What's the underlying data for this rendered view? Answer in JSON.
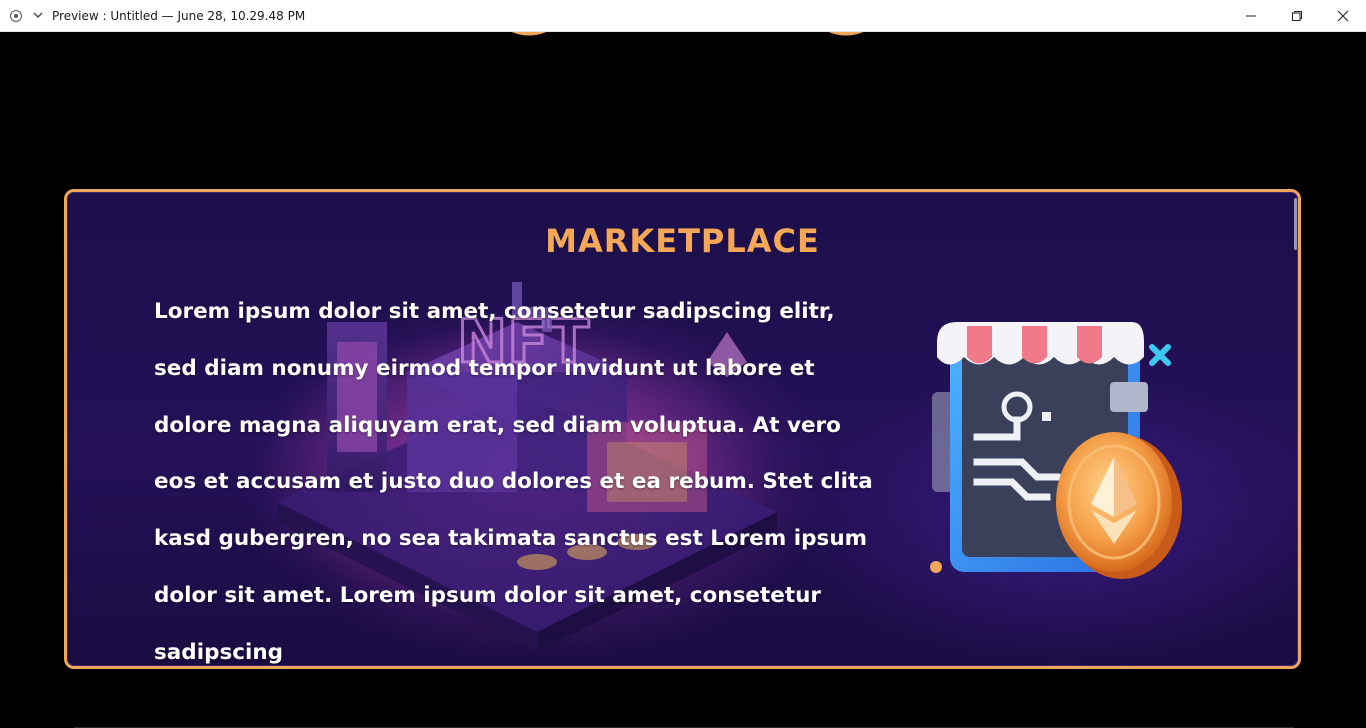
{
  "window": {
    "title": "Preview : Untitled — June 28, 10.29.48 PM"
  },
  "card": {
    "title": "MARKETPLACE",
    "body": "Lorem ipsum dolor sit amet, consetetur sadipscing elitr, sed diam nonumy eirmod tempor invidunt ut labore et dolore magna aliquyam erat, sed diam voluptua. At vero eos et accusam et justo duo dolores et ea rebum. Stet clita kasd gubergren, no sea takimata sanctus est Lorem ipsum dolor sit amet. Lorem ipsum dolor sit amet, consetetur sadipscing"
  },
  "illustration": {
    "background_sign": "NFT"
  },
  "colors": {
    "accent": "#f4a857",
    "card_border": "#f0a65a",
    "card_background": "#1f0f4e",
    "page_background": "#000000"
  },
  "icons": {
    "app": "app-record-icon",
    "menu": "chevron-down-icon",
    "minimize": "minimize-icon",
    "maximize": "restore-icon",
    "close": "close-icon"
  }
}
